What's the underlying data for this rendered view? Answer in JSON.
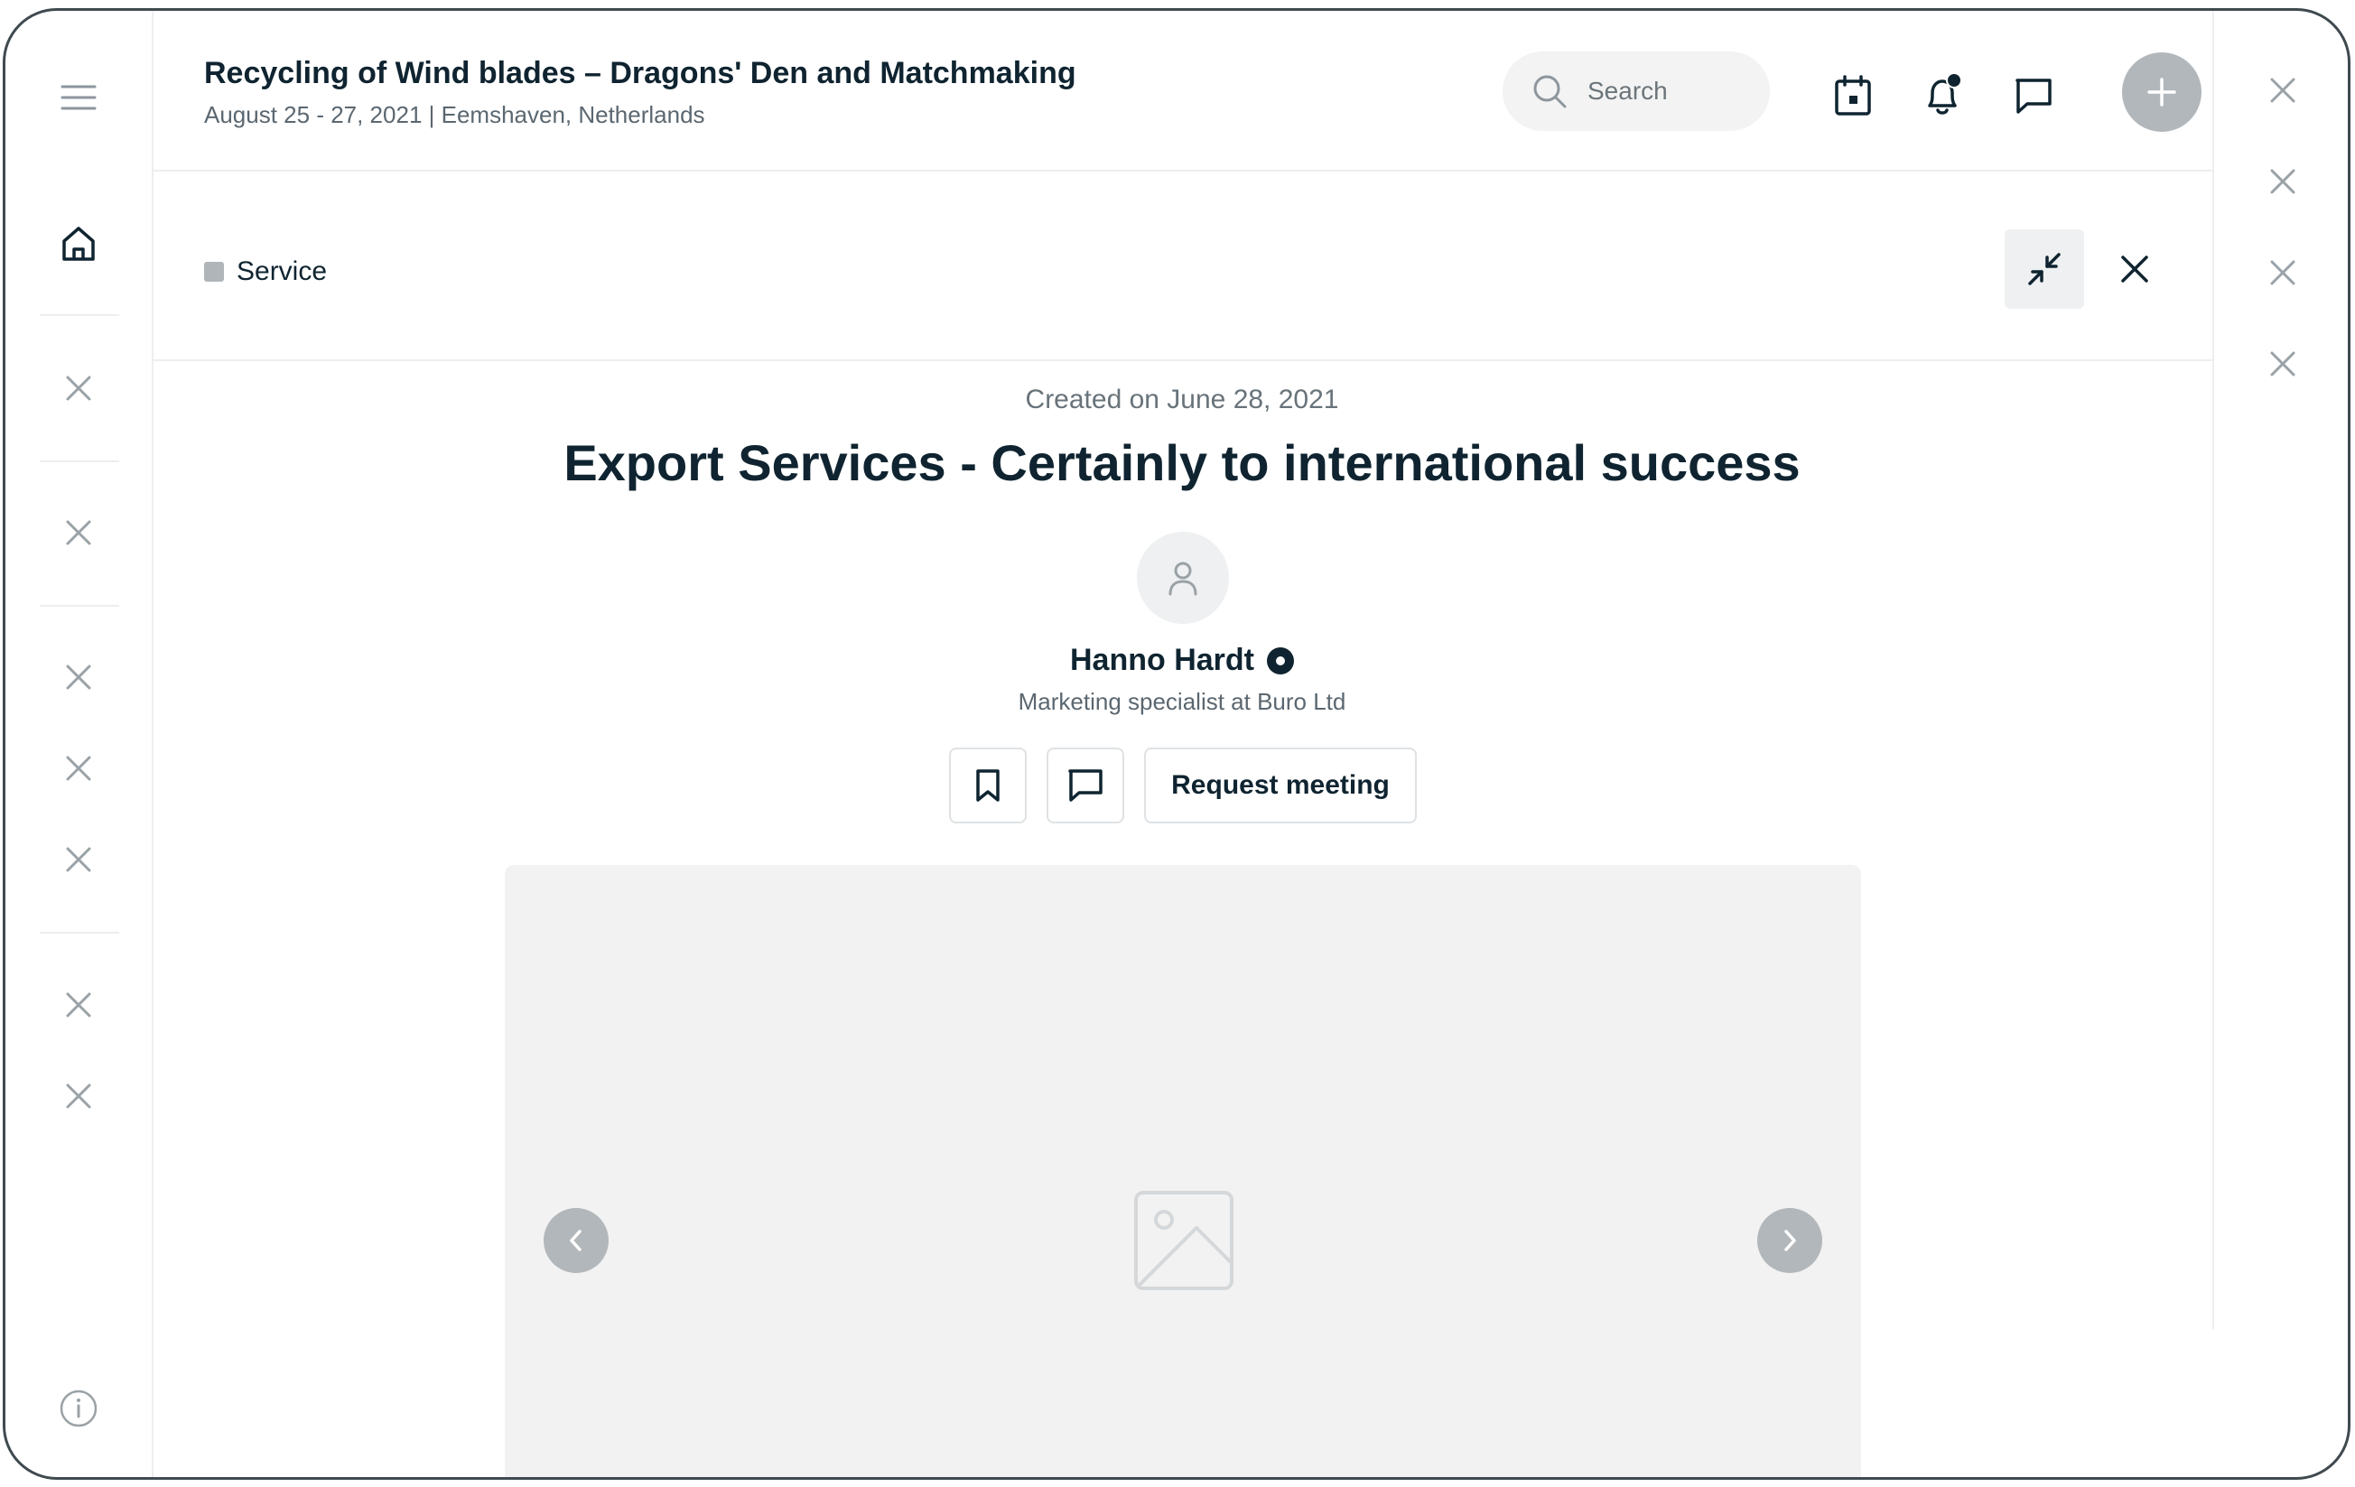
{
  "event": {
    "title": "Recycling of Wind blades – Dragons' Den and Matchmaking",
    "subtitle": "August 25 - 27, 2021  |  Eemshaven, Netherlands"
  },
  "search": {
    "placeholder": "Search"
  },
  "header_icons": [
    "calendar-icon",
    "bell-icon",
    "chat-icon",
    "plus-icon"
  ],
  "notifications": {
    "has_unread": true
  },
  "sidebar": {
    "items": [
      "menu-icon",
      "home-icon",
      "close-icon",
      "close-icon",
      "close-icon",
      "close-icon",
      "close-icon",
      "close-icon",
      "close-icon",
      "info-icon"
    ]
  },
  "panel": {
    "tag": "Service",
    "created": "Created on June 28, 2021",
    "title": "Export Services - Certainly to international success",
    "author_name": "Hanno Hardt",
    "author_role": "Marketing specialist at Buro Ltd",
    "request_label": "Request meeting"
  },
  "colors": {
    "text": "#0f2430",
    "muted": "#5b6770",
    "accent_gray": "#b2b7bb",
    "surface": "#f2f2f2",
    "border": "#eceeef"
  }
}
